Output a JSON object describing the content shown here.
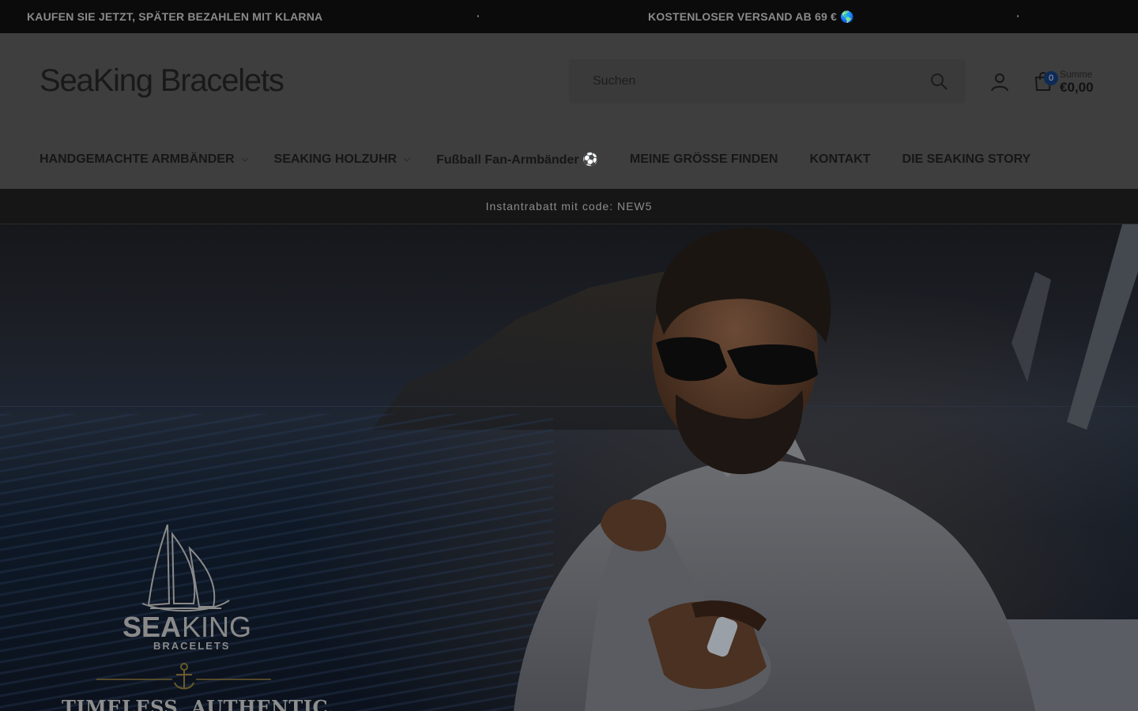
{
  "announcement": {
    "messages": [
      "KAUFEN SIE JETZT, SPÄTER BEZAHLEN MIT KLARNA",
      "KOSTENLOSER VERSAND AB 69 € 🌎"
    ],
    "separator": "·"
  },
  "header": {
    "logo": "SeaKing Bracelets",
    "search_placeholder": "Suchen",
    "cart": {
      "count": "0",
      "sum_label": "Summe",
      "sum_value": "€0,00"
    }
  },
  "nav": {
    "items": [
      {
        "label": "HANDGEMACHTE ARMBÄNDER",
        "dropdown": true
      },
      {
        "label": "SEAKING HOLZUHR",
        "dropdown": true
      },
      {
        "label": "Fußball Fan-Armbänder ⚽",
        "dropdown": false
      },
      {
        "label": "MEINE GRÖSSE FINDEN",
        "dropdown": false
      },
      {
        "label": "KONTAKT",
        "dropdown": false
      },
      {
        "label": "DIE SEAKING STORY",
        "dropdown": false
      }
    ]
  },
  "promo": {
    "text": "Instantrabatt mit code: NEW5"
  },
  "hero": {
    "brand_sea": "SEA",
    "brand_king": "KING",
    "brand_sub": "BRACELETS",
    "tagline": "TIMELESS. AUTHENTIC."
  },
  "colors": {
    "page_bg": "#161616",
    "header_bg": "#3e3e3e",
    "badge": "#0e2a55"
  },
  "icons": [
    "search-icon",
    "account-icon",
    "cart-icon",
    "chevron-down-icon",
    "anchor-icon",
    "ship-logo-icon"
  ]
}
